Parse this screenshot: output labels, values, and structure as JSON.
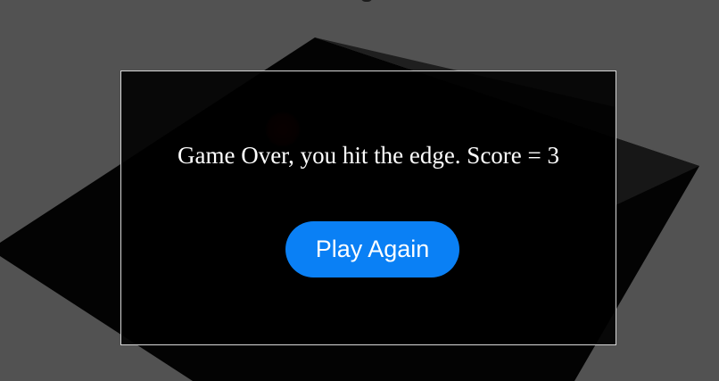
{
  "game": {
    "message": "Game Over, you hit the edge. Score = 3",
    "score": 3,
    "play_again_label": "Play Again"
  },
  "colors": {
    "background": "#525252",
    "board": "#030303",
    "board_edge": "#1a1a1a",
    "ball": "#4a0000",
    "dialog_border": "#d8d8d8",
    "button": "#0a80f5",
    "text": "#ffffff"
  }
}
